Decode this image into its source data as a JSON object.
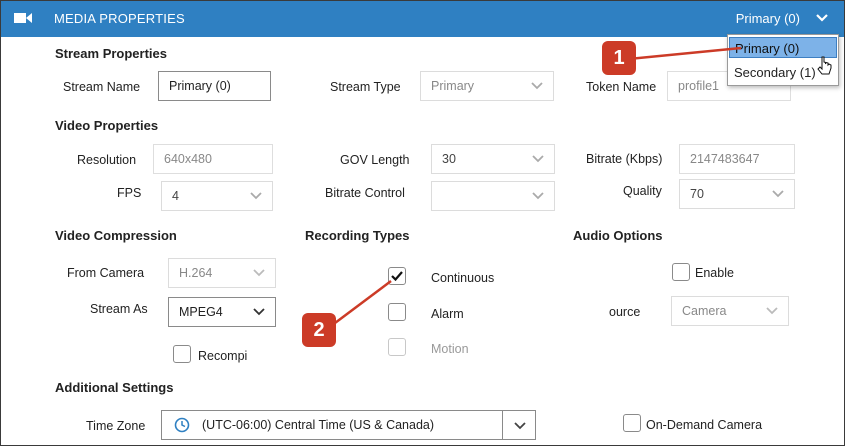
{
  "header": {
    "title": "MEDIA PROPERTIES",
    "selected_stream": "Primary (0)"
  },
  "dropdown": {
    "options": [
      "Primary (0)",
      "Secondary (1)"
    ]
  },
  "badges": [
    "1",
    "2"
  ],
  "stream_properties": {
    "heading": "Stream Properties",
    "stream_name_label": "Stream Name",
    "stream_name_value": "Primary (0)",
    "stream_type_label": "Stream Type",
    "stream_type_value": "Primary",
    "token_name_label": "Token Name",
    "token_name_value": "profile1"
  },
  "video_properties": {
    "heading": "Video Properties",
    "resolution_label": "Resolution",
    "resolution_value": "640x480",
    "gov_length_label": "GOV Length",
    "gov_length_value": "30",
    "bitrate_label": "Bitrate (Kbps)",
    "bitrate_value": "2147483647",
    "fps_label": "FPS",
    "fps_value": "4",
    "bitrate_control_label": "Bitrate Control",
    "bitrate_control_value": "",
    "quality_label": "Quality",
    "quality_value": "70"
  },
  "video_compression": {
    "heading": "Video Compression",
    "from_camera_label": "From Camera",
    "from_camera_value": "H.264",
    "stream_as_label": "Stream As",
    "stream_as_value": "MPEG4",
    "recompress_label": "Recompi"
  },
  "recording_types": {
    "heading": "Recording Types",
    "continuous_label": "Continuous",
    "continuous_checked": true,
    "alarm_label": "Alarm",
    "motion_label": "Motion"
  },
  "audio_options": {
    "heading": "Audio Options",
    "enable_label": "Enable",
    "source_label": "ource",
    "source_value": "Camera"
  },
  "additional_settings": {
    "heading": "Additional Settings",
    "time_zone_label": "Time Zone",
    "time_zone_value": "(UTC-06:00) Central Time (US & Canada)",
    "on_demand_label": "On-Demand Camera"
  },
  "colors": {
    "header_blue": "#2f80c2",
    "badge_red": "#cc3b27",
    "highlight_blue": "#7db2e8"
  },
  "icons": [
    "video-camera-icon",
    "chevron-down-icon",
    "clock-icon",
    "check-icon",
    "mouse-cursor-icon"
  ]
}
